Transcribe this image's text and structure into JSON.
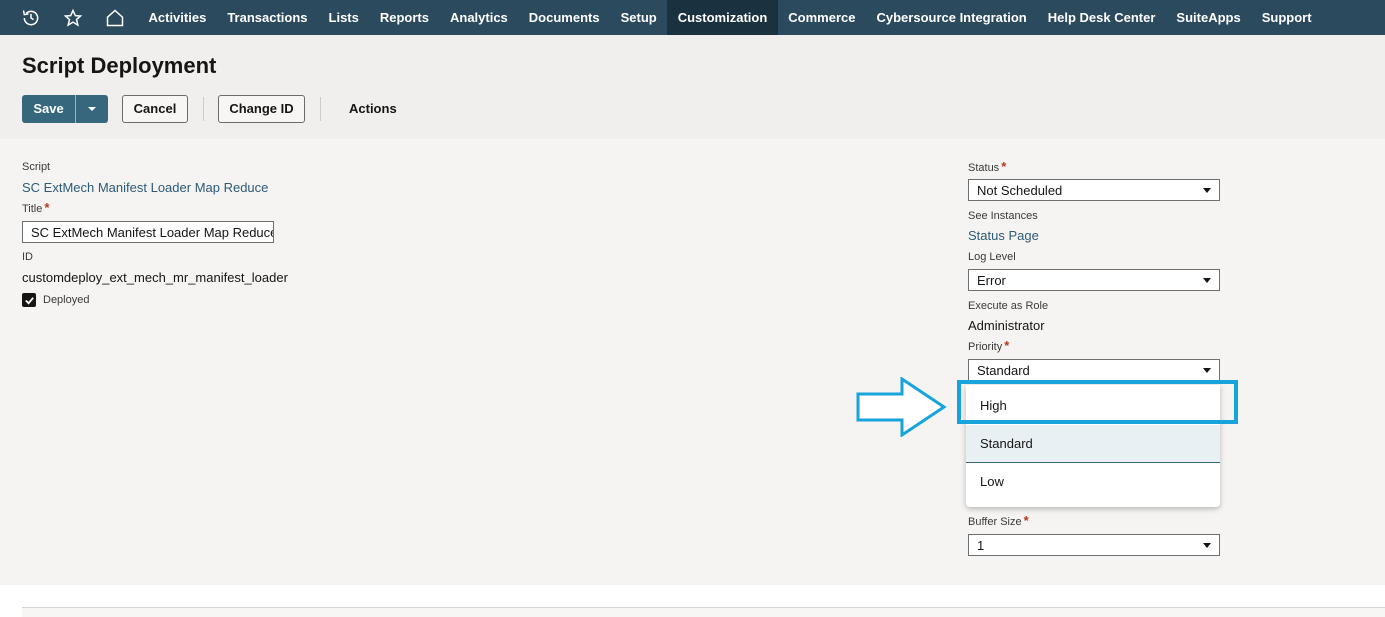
{
  "nav": {
    "icons": [
      "recent-icon",
      "star-icon",
      "home-icon"
    ],
    "items": [
      {
        "label": "Activities"
      },
      {
        "label": "Transactions"
      },
      {
        "label": "Lists"
      },
      {
        "label": "Reports"
      },
      {
        "label": "Analytics"
      },
      {
        "label": "Documents"
      },
      {
        "label": "Setup"
      },
      {
        "label": "Customization",
        "active": true
      },
      {
        "label": "Commerce"
      },
      {
        "label": "Cybersource Integration"
      },
      {
        "label": "Help Desk Center"
      },
      {
        "label": "SuiteApps"
      },
      {
        "label": "Support"
      }
    ],
    "bg_color": "#2c4a5e",
    "active_color": "#1a3140"
  },
  "header": {
    "title": "Script Deployment",
    "save_label": "Save",
    "cancel_label": "Cancel",
    "change_id_label": "Change ID",
    "actions_label": "Actions",
    "accent_color": "#36677d"
  },
  "left": {
    "script_label": "Script",
    "script_value": "SC ExtMech Manifest Loader Map Reduce",
    "title_label": "Title",
    "title_value": "SC ExtMech Manifest Loader Map Reduce",
    "id_label": "ID",
    "id_value": "customdeploy_ext_mech_mr_manifest_loader",
    "deployed_label": "Deployed",
    "deployed_checked": true
  },
  "right": {
    "status_label": "Status",
    "status_value": "Not Scheduled",
    "see_instances_label": "See Instances",
    "status_page_link": "Status Page",
    "log_level_label": "Log Level",
    "log_level_value": "Error",
    "execute_as_role_label": "Execute as Role",
    "execute_as_role_value": "Administrator",
    "priority_label": "Priority",
    "priority_value": "Standard",
    "priority_options": [
      "High",
      "Standard",
      "Low"
    ],
    "priority_selected": "Standard",
    "buffer_size_label": "Buffer Size",
    "buffer_size_value": "1"
  },
  "annotation": {
    "highlight_color": "#17a3dc"
  },
  "required_mark": "*"
}
